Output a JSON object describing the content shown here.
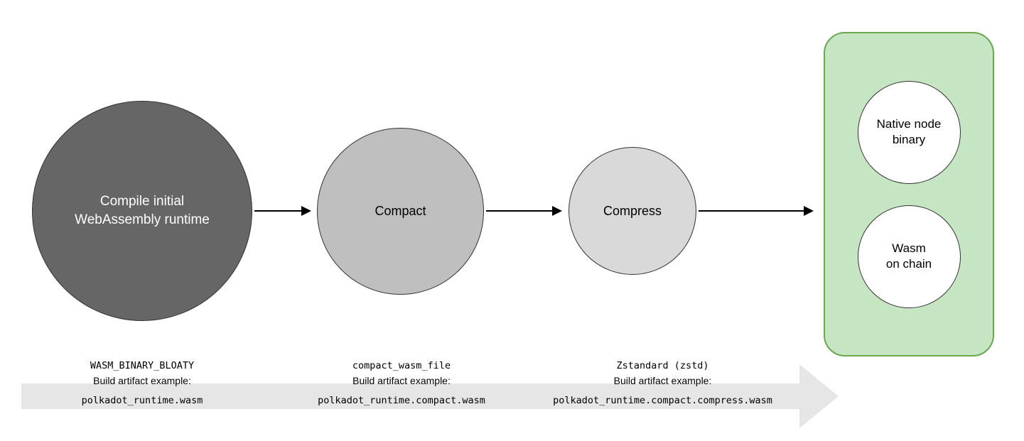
{
  "stages": {
    "compile": {
      "label": "Compile initial\nWebAssembly runtime",
      "code": "WASM_BINARY_BLOATY",
      "artifact_label": "Build artifact example:",
      "artifact": "polkadot_runtime.wasm"
    },
    "compact": {
      "label": "Compact",
      "code": "compact_wasm_file",
      "artifact_label": "Build artifact example:",
      "artifact": "polkadot_runtime.compact.wasm"
    },
    "compress": {
      "label": "Compress",
      "code": "Zstandard (zstd)",
      "artifact_label": "Build artifact example:",
      "artifact": "polkadot_runtime.compact.compress.wasm"
    }
  },
  "results": {
    "native": "Native node\nbinary",
    "wasm": "Wasm\non chain"
  }
}
